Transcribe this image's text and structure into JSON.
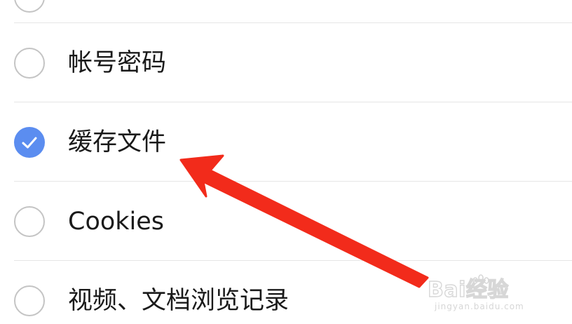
{
  "options": [
    {
      "id": "accounts",
      "label": "帐号密码",
      "checked": false
    },
    {
      "id": "cache",
      "label": "缓存文件",
      "checked": true
    },
    {
      "id": "cookies",
      "label": "Cookies",
      "checked": false
    },
    {
      "id": "history",
      "label": "视频、文档浏览记录",
      "checked": false
    }
  ],
  "watermark": {
    "logo_text": "Bai经验",
    "url": "jingyan.baidu.com"
  },
  "colors": {
    "checked": "#5b8df0",
    "unchecked_border": "#c4c4c4",
    "arrow": "#f22b1b",
    "divider": "#e6e6e6"
  }
}
